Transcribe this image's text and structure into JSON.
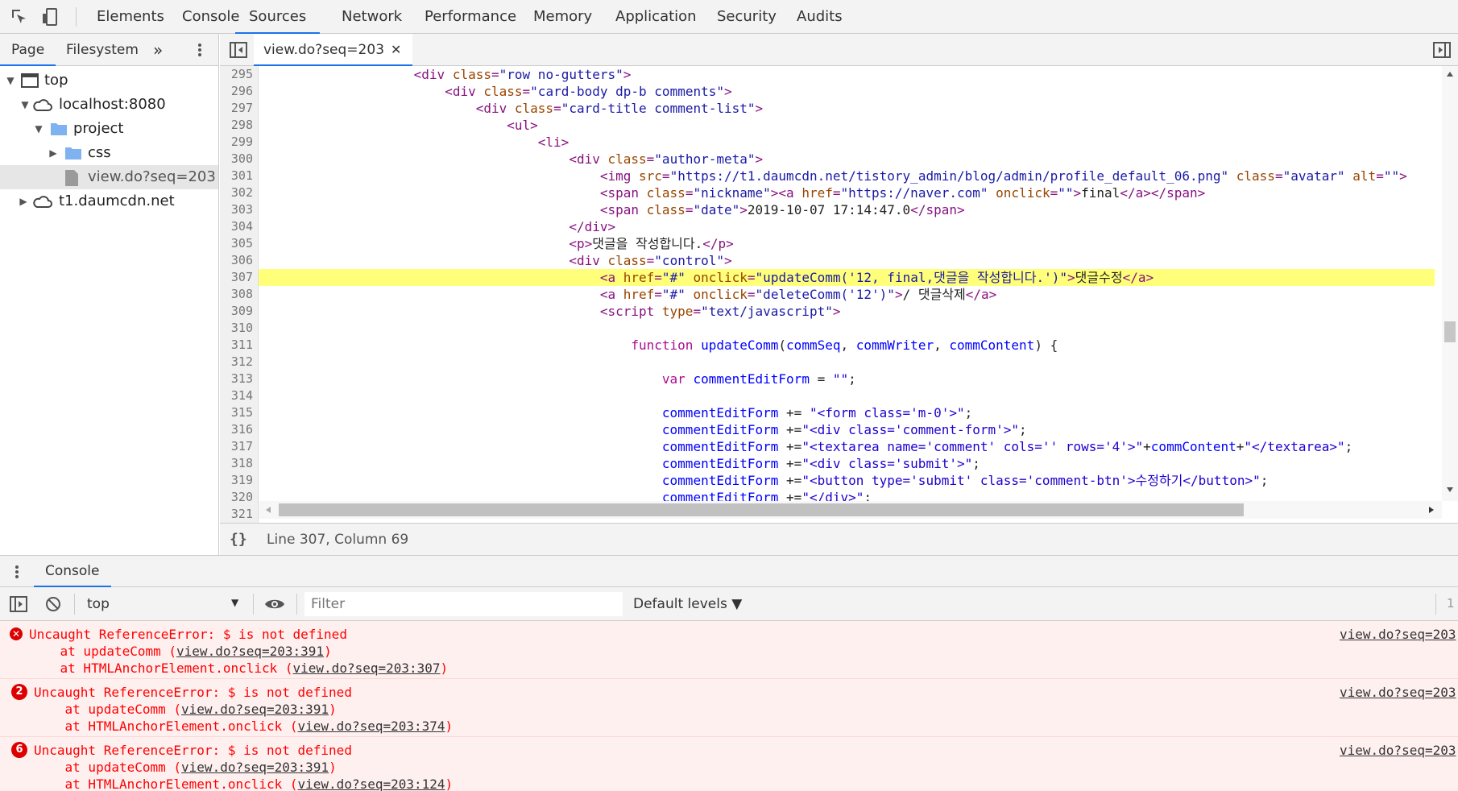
{
  "main_tabs": [
    "Elements",
    "Console",
    "Sources",
    "Network",
    "Performance",
    "Memory",
    "Application",
    "Security",
    "Audits"
  ],
  "active_main_tab": "Sources",
  "navigator": {
    "tabs": [
      "Page",
      "Filesystem"
    ],
    "more": "»",
    "tree": [
      {
        "label": "top"
      },
      {
        "label": "localhost:8080"
      },
      {
        "label": "project"
      },
      {
        "label": "css"
      },
      {
        "label": "view.do?seq=203"
      },
      {
        "label": "t1.daumcdn.net"
      }
    ]
  },
  "editor": {
    "tab_label": "view.do?seq=203",
    "close_glyph": "✕",
    "highlighted_line": "307",
    "line_numbers": [
      "295",
      "296",
      "297",
      "298",
      "299",
      "300",
      "301",
      "302",
      "303",
      "304",
      "305",
      "306",
      "307",
      "308",
      "309",
      "310",
      "311",
      "312",
      "313",
      "314",
      "315",
      "316",
      "317",
      "318",
      "319",
      "320",
      "321"
    ],
    "status": "Line 307, Column 69",
    "format_glyph": "{}"
  },
  "drawer": {
    "tab_label": "Console",
    "context": "top",
    "filter_placeholder": "Filter",
    "levels": "Default levels ▼",
    "right_count": "1"
  },
  "console_messages": [
    {
      "badge": "✕",
      "message": "Uncaught ReferenceError: $ is not defined",
      "stack1_prefix": "    at updateComm (",
      "stack1_link": "view.do?seq=203:391",
      "stack2_prefix": "    at HTMLAnchorElement.onclick (",
      "stack2_link": "view.do?seq=203:307",
      "suffix": ")",
      "source": "view.do?seq=203"
    },
    {
      "badge": "2",
      "message": "Uncaught ReferenceError: $ is not defined",
      "stack1_prefix": "    at updateComm (",
      "stack1_link": "view.do?seq=203:391",
      "stack2_prefix": "    at HTMLAnchorElement.onclick (",
      "stack2_link": "view.do?seq=203:374",
      "suffix": ")",
      "source": "view.do?seq=203"
    },
    {
      "badge": "6",
      "message": "Uncaught ReferenceError: $ is not defined",
      "stack1_prefix": "    at updateComm (",
      "stack1_link": "view.do?seq=203:391",
      "stack2_prefix": "    at HTMLAnchorElement.onclick (",
      "stack2_link": "view.do?seq=203:124",
      "suffix": ")",
      "source": "view.do?seq=203"
    }
  ],
  "code_lines": [
    [
      [
        "                    ",
        ""
      ],
      [
        "<div ",
        "tg"
      ],
      [
        "class",
        "at"
      ],
      [
        "=",
        "tg"
      ],
      [
        "\"row no-gutters\"",
        "vl"
      ],
      [
        ">",
        "tg"
      ]
    ],
    [
      [
        "                        ",
        ""
      ],
      [
        "<div ",
        "tg"
      ],
      [
        "class",
        "at"
      ],
      [
        "=",
        "tg"
      ],
      [
        "\"card-body dp-b comments\"",
        "vl"
      ],
      [
        ">",
        "tg"
      ]
    ],
    [
      [
        "                            ",
        ""
      ],
      [
        "<div ",
        "tg"
      ],
      [
        "class",
        "at"
      ],
      [
        "=",
        "tg"
      ],
      [
        "\"card-title comment-list\"",
        "vl"
      ],
      [
        ">",
        "tg"
      ]
    ],
    [
      [
        "                                ",
        ""
      ],
      [
        "<ul>",
        "tg"
      ]
    ],
    [
      [
        "                                    ",
        ""
      ],
      [
        "<li>",
        "tg"
      ]
    ],
    [
      [
        "                                        ",
        ""
      ],
      [
        "<div ",
        "tg"
      ],
      [
        "class",
        "at"
      ],
      [
        "=",
        "tg"
      ],
      [
        "\"author-meta\"",
        "vl"
      ],
      [
        ">",
        "tg"
      ]
    ],
    [
      [
        "                                            ",
        ""
      ],
      [
        "<img ",
        "tg"
      ],
      [
        "src",
        "at"
      ],
      [
        "=",
        "tg"
      ],
      [
        "\"https://t1.daumcdn.net/tistory_admin/blog/admin/profile_default_06.png\"",
        "vl"
      ],
      [
        " ",
        ""
      ],
      [
        "class",
        "at"
      ],
      [
        "=",
        "tg"
      ],
      [
        "\"avatar\"",
        "vl"
      ],
      [
        " ",
        ""
      ],
      [
        "alt",
        "at"
      ],
      [
        "=",
        "tg"
      ],
      [
        "\"\"",
        "vl"
      ],
      [
        ">",
        "tg"
      ]
    ],
    [
      [
        "                                            ",
        ""
      ],
      [
        "<span ",
        "tg"
      ],
      [
        "class",
        "at"
      ],
      [
        "=",
        "tg"
      ],
      [
        "\"nickname\"",
        "vl"
      ],
      [
        "><a ",
        "tg"
      ],
      [
        "href",
        "at"
      ],
      [
        "=",
        "tg"
      ],
      [
        "\"https://naver.com\"",
        "vl"
      ],
      [
        " ",
        ""
      ],
      [
        "onclick",
        "at"
      ],
      [
        "=",
        "tg"
      ],
      [
        "\"\"",
        "vl"
      ],
      [
        ">",
        "tg"
      ],
      [
        "final",
        ""
      ],
      [
        "</a></span>",
        "tg"
      ]
    ],
    [
      [
        "                                            ",
        ""
      ],
      [
        "<span ",
        "tg"
      ],
      [
        "class",
        "at"
      ],
      [
        "=",
        "tg"
      ],
      [
        "\"date\"",
        "vl"
      ],
      [
        ">",
        "tg"
      ],
      [
        "2019-10-07 17:14:47.0",
        ""
      ],
      [
        "</span>",
        "tg"
      ]
    ],
    [
      [
        "                                        ",
        ""
      ],
      [
        "</div>",
        "tg"
      ]
    ],
    [
      [
        "                                        ",
        ""
      ],
      [
        "<p>",
        "tg"
      ],
      [
        "댓글을 작성합니다.",
        ""
      ],
      [
        "</p>",
        "tg"
      ]
    ],
    [
      [
        "                                        ",
        ""
      ],
      [
        "<div ",
        "tg"
      ],
      [
        "class",
        "at"
      ],
      [
        "=",
        "tg"
      ],
      [
        "\"control\"",
        "vl"
      ],
      [
        ">",
        "tg"
      ]
    ],
    [
      [
        "                                            ",
        ""
      ],
      [
        "<a ",
        "tg"
      ],
      [
        "href",
        "at"
      ],
      [
        "=",
        "tg"
      ],
      [
        "\"#\"",
        "vl"
      ],
      [
        " ",
        ""
      ],
      [
        "onclick",
        "at"
      ],
      [
        "=",
        "tg"
      ],
      [
        "\"updateComm('12, final,댓글을 작성합니다.')\"",
        "vl"
      ],
      [
        ">",
        "tg"
      ],
      [
        "댓글수정",
        ""
      ],
      [
        "</a>",
        "tg"
      ]
    ],
    [
      [
        "                                            ",
        ""
      ],
      [
        "<a ",
        "tg"
      ],
      [
        "href",
        "at"
      ],
      [
        "=",
        "tg"
      ],
      [
        "\"#\"",
        "vl"
      ],
      [
        " ",
        ""
      ],
      [
        "onclick",
        "at"
      ],
      [
        "=",
        "tg"
      ],
      [
        "\"deleteComm('12')\"",
        "vl"
      ],
      [
        ">",
        "tg"
      ],
      [
        "/ 댓글삭제",
        ""
      ],
      [
        "</a>",
        "tg"
      ]
    ],
    [
      [
        "                                            ",
        ""
      ],
      [
        "<script ",
        "tg"
      ],
      [
        "type",
        "at"
      ],
      [
        "=",
        "tg"
      ],
      [
        "\"text/javascript\"",
        "vl"
      ],
      [
        ">",
        "tg"
      ]
    ],
    [
      [
        "",
        ""
      ]
    ],
    [
      [
        "                                                ",
        ""
      ],
      [
        "function",
        "kw"
      ],
      [
        " ",
        ""
      ],
      [
        "updateComm",
        "jv"
      ],
      [
        "(",
        ""
      ],
      [
        "commSeq",
        "jv"
      ],
      [
        ", ",
        ""
      ],
      [
        "commWriter",
        "jv"
      ],
      [
        ", ",
        ""
      ],
      [
        "commContent",
        "jv"
      ],
      [
        ") {",
        ""
      ]
    ],
    [
      [
        "",
        ""
      ]
    ],
    [
      [
        "                                                    ",
        ""
      ],
      [
        "var",
        "kw"
      ],
      [
        " ",
        ""
      ],
      [
        "commentEditForm",
        "jv"
      ],
      [
        " = ",
        ""
      ],
      [
        "\"\"",
        "fn"
      ],
      [
        ";",
        ""
      ]
    ],
    [
      [
        "",
        ""
      ]
    ],
    [
      [
        "                                                    ",
        ""
      ],
      [
        "commentEditForm",
        "jv"
      ],
      [
        " += ",
        ""
      ],
      [
        "\"<form class='m-0'>\"",
        "fn"
      ],
      [
        ";",
        ""
      ]
    ],
    [
      [
        "                                                    ",
        ""
      ],
      [
        "commentEditForm",
        "jv"
      ],
      [
        " +=",
        ""
      ],
      [
        "\"<div class='comment-form'>\"",
        "fn"
      ],
      [
        ";",
        ""
      ]
    ],
    [
      [
        "                                                    ",
        ""
      ],
      [
        "commentEditForm",
        "jv"
      ],
      [
        " +=",
        ""
      ],
      [
        "\"<textarea name='comment' cols='' rows='4'>\"",
        "fn"
      ],
      [
        "+",
        ""
      ],
      [
        "commContent",
        "jv"
      ],
      [
        "+",
        ""
      ],
      [
        "\"</textarea>\"",
        "fn"
      ],
      [
        ";",
        ""
      ]
    ],
    [
      [
        "                                                    ",
        ""
      ],
      [
        "commentEditForm",
        "jv"
      ],
      [
        " +=",
        ""
      ],
      [
        "\"<div class='submit'>\"",
        "fn"
      ],
      [
        ";",
        ""
      ]
    ],
    [
      [
        "                                                    ",
        ""
      ],
      [
        "commentEditForm",
        "jv"
      ],
      [
        " +=",
        ""
      ],
      [
        "\"<button type='submit' class='comment-btn'>수정하기</button>\"",
        "fn"
      ],
      [
        ";",
        ""
      ]
    ],
    [
      [
        "                                                    ",
        ""
      ],
      [
        "commentEditForm",
        "jv"
      ],
      [
        " +=",
        ""
      ],
      [
        "\"</div>\"",
        "fn"
      ],
      [
        ";",
        ""
      ]
    ],
    [
      [
        "",
        ""
      ]
    ]
  ],
  "colors": {
    "accent": "#1a73e8",
    "highlight": "#ffff7a",
    "error_bg": "#fff0f0",
    "error_text": "#ff0000",
    "folder": "#7fb2f0"
  }
}
